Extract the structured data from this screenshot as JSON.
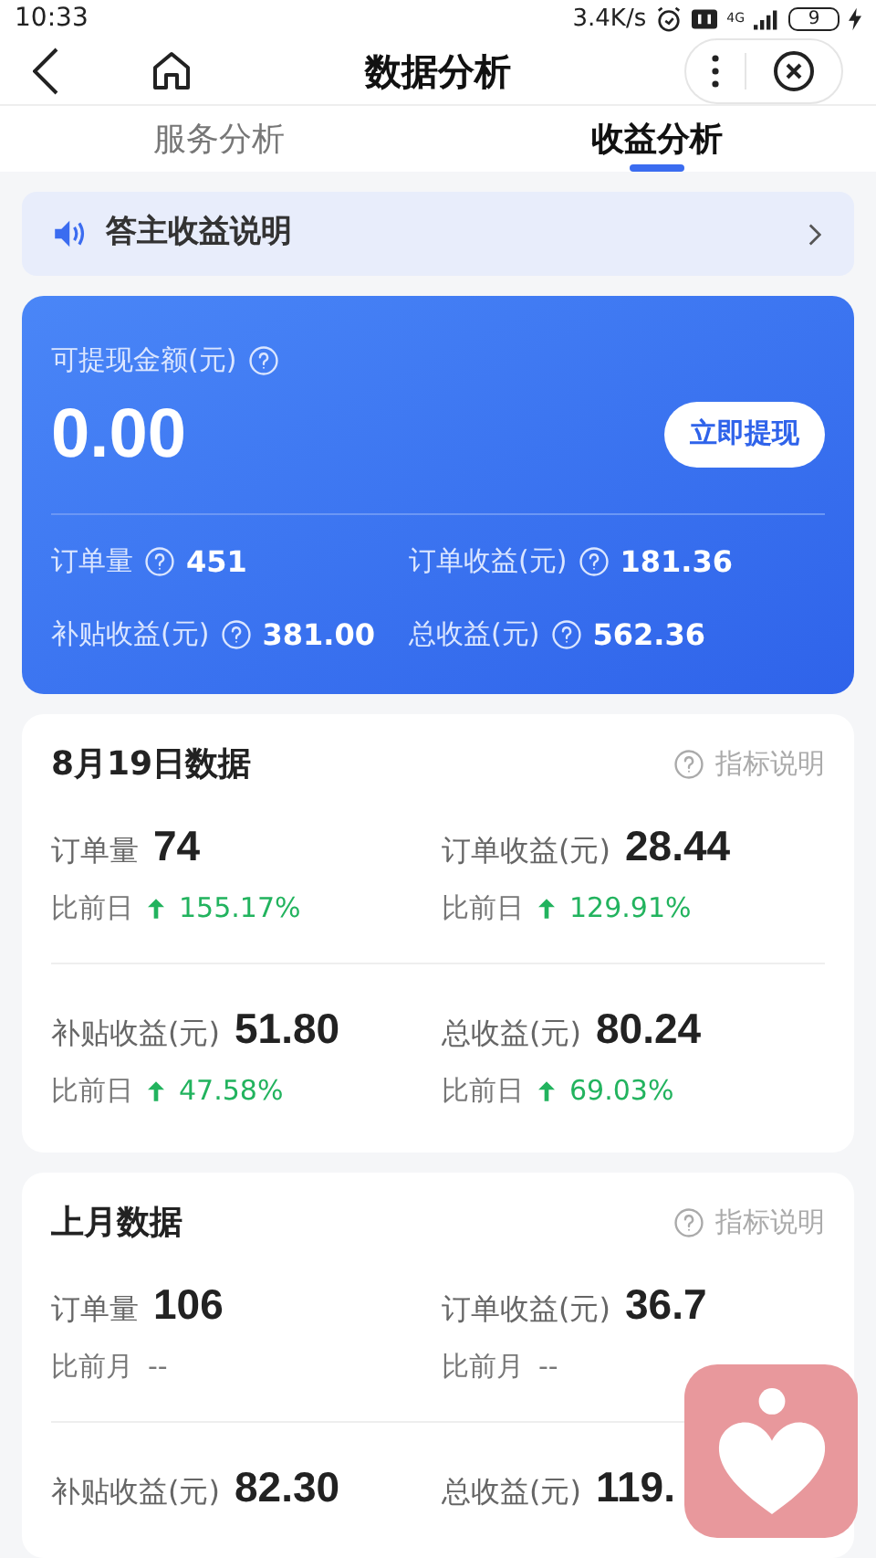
{
  "status_bar": {
    "time": "10:33",
    "speed": "3.4K/s",
    "network": "4G",
    "battery": "9"
  },
  "nav": {
    "title": "数据分析"
  },
  "tabs": [
    {
      "label": "服务分析",
      "selected": false
    },
    {
      "label": "收益分析",
      "selected": true
    }
  ],
  "notice": {
    "text": "答主收益说明"
  },
  "balance_card": {
    "label": "可提现金额(元)",
    "amount": "0.00",
    "button": "立即提现",
    "stats": [
      {
        "label": "订单量",
        "value": "451"
      },
      {
        "label": "订单收益(元)",
        "value": "181.36"
      },
      {
        "label": "补贴收益(元)",
        "value": "381.00"
      },
      {
        "label": "总收益(元)",
        "value": "562.36"
      }
    ]
  },
  "sections": [
    {
      "title": "8月19日数据",
      "help": "指标说明",
      "metrics": [
        {
          "label": "订单量",
          "value": "74",
          "compare_label": "比前日",
          "up": true,
          "change": "155.17%"
        },
        {
          "label": "订单收益(元)",
          "value": "28.44",
          "compare_label": "比前日",
          "up": true,
          "change": "129.91%"
        },
        {
          "label": "补贴收益(元)",
          "value": "51.80",
          "compare_label": "比前日",
          "up": true,
          "change": "47.58%"
        },
        {
          "label": "总收益(元)",
          "value": "80.24",
          "compare_label": "比前日",
          "up": true,
          "change": "69.03%"
        }
      ]
    },
    {
      "title": "上月数据",
      "help": "指标说明",
      "metrics": [
        {
          "label": "订单量",
          "value": "106",
          "compare_label": "比前月",
          "up": false,
          "change": "--"
        },
        {
          "label": "订单收益(元)",
          "value": "36.7",
          "compare_label": "比前月",
          "up": false,
          "change": "--"
        },
        {
          "label": "补贴收益(元)",
          "value": "82.30"
        },
        {
          "label": "总收益(元)",
          "value": "119."
        }
      ]
    }
  ]
}
